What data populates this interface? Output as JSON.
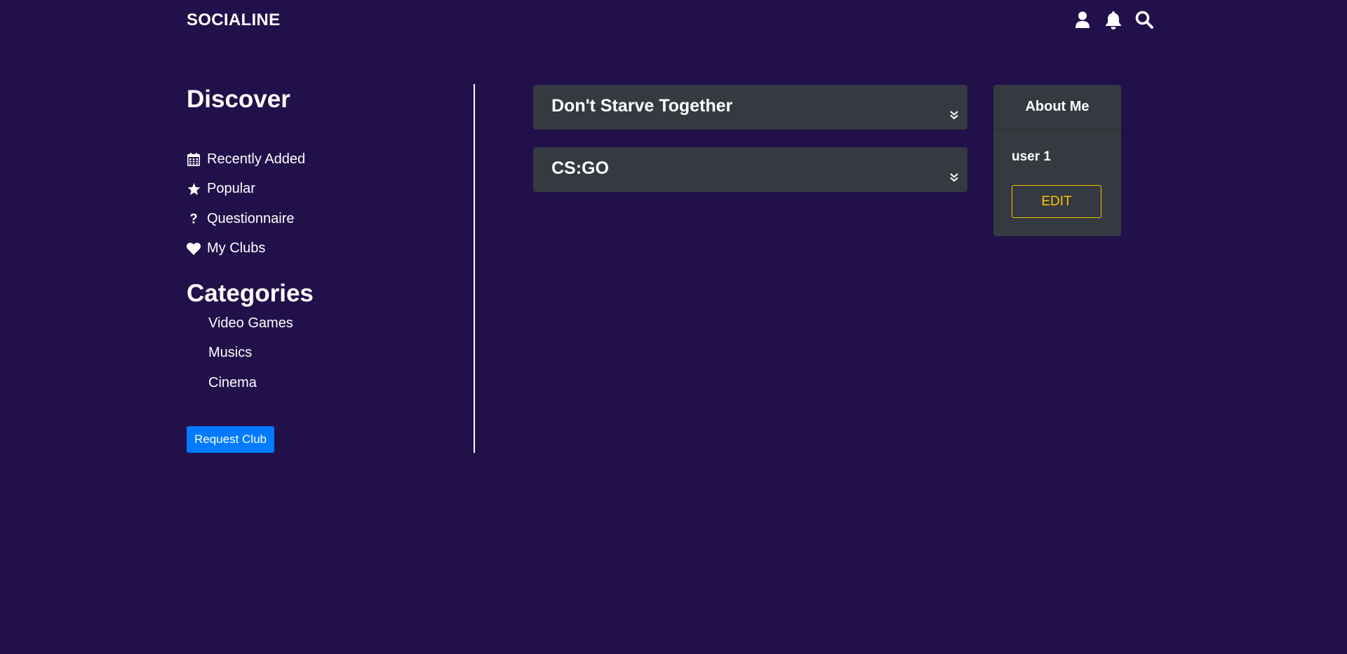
{
  "header": {
    "brand": "SOCIALINE",
    "icons": [
      "user-icon",
      "bell-icon",
      "search-icon"
    ]
  },
  "sidebar": {
    "discover_title": "Discover",
    "discover_items": [
      {
        "label": "Recently Added",
        "icon": "calendar-icon"
      },
      {
        "label": "Popular",
        "icon": "star-icon"
      },
      {
        "label": "Questionnaire",
        "icon": "question-icon"
      },
      {
        "label": "My Clubs",
        "icon": "heart-icon"
      }
    ],
    "categories_title": "Categories",
    "categories": [
      {
        "label": "Video Games"
      },
      {
        "label": "Musics"
      },
      {
        "label": "Cinema"
      }
    ],
    "request_button": "Request Club"
  },
  "clubs": [
    {
      "title": "Don't Starve Together",
      "icon": "chevron-double-down-icon"
    },
    {
      "title": "CS:GO",
      "icon": "chevron-double-down-icon"
    }
  ],
  "about": {
    "title": "About Me",
    "username": "user 1",
    "edit_button": "EDIT"
  },
  "colors": {
    "background": "#21104a",
    "card": "#343a40",
    "primary": "#007bff",
    "warning": "#ffc107",
    "text": "#ffffff"
  }
}
